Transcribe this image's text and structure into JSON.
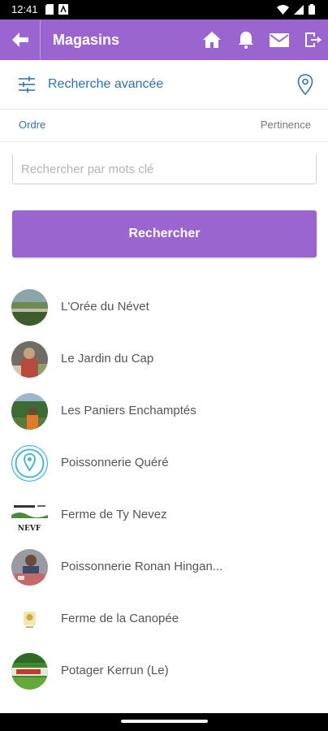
{
  "status_bar": {
    "time": "12:41"
  },
  "app_bar": {
    "title": "Magasins",
    "icons": [
      "back-arrow-icon",
      "home-icon",
      "bell-icon",
      "mail-icon",
      "logout-icon"
    ]
  },
  "advanced_search": {
    "label": "Recherche avancée"
  },
  "order": {
    "label": "Ordre",
    "value": "Pertinence"
  },
  "search": {
    "placeholder": "Rechercher par mots clé",
    "value": ""
  },
  "search_button": {
    "label": "Rechercher"
  },
  "stores": [
    {
      "name": "L'Orée du Névet"
    },
    {
      "name": "Le Jardin du Cap"
    },
    {
      "name": "Les Paniers Enchamptés"
    },
    {
      "name": "Poissonnerie Quéré"
    },
    {
      "name": "Ferme de Ty Nevez"
    },
    {
      "name": "Poissonnerie Ronan Hingan..."
    },
    {
      "name": "Ferme de la Canopée"
    },
    {
      "name": "Potager Kerrun (Le)"
    }
  ],
  "logo_text": {
    "ferme_ty_nevez": "NEVF"
  },
  "colors": {
    "accent": "#9b65cf",
    "link": "#2f6fb0"
  }
}
